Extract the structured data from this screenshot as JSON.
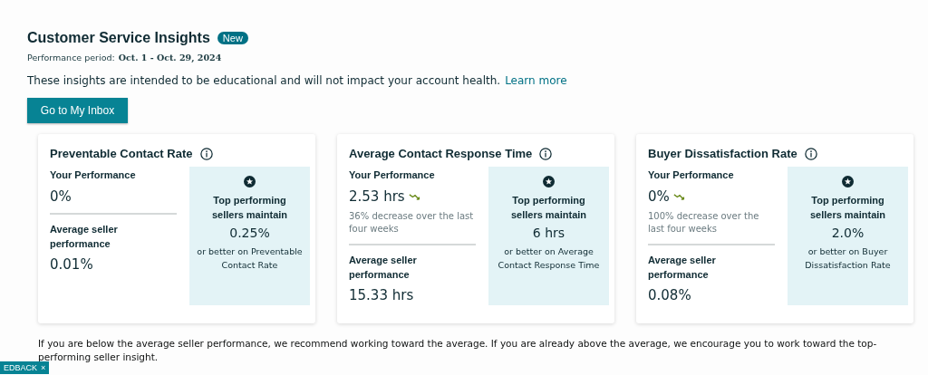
{
  "header": {
    "title": "Customer Service Insights",
    "badge": "New",
    "period_label": "Performance period:",
    "period_value": "Oct. 1 - Oct. 29, 2024"
  },
  "intro": {
    "text": "These insights are intended to be educational and will not impact your account health.",
    "link": "Learn more"
  },
  "inbox_button": "Go to My Inbox",
  "cards": [
    {
      "title": "Preventable Contact Rate",
      "your_label": "Your Performance",
      "your_value": "0%",
      "trend_down": false,
      "avg_label": "Average seller performance",
      "avg_value": "0.01%",
      "top_label": "Top performing sellers maintain",
      "top_value": "0.25%",
      "top_note": "or better on Preventable Contact Rate"
    },
    {
      "title": "Average Contact Response Time",
      "your_label": "Your Performance",
      "your_value": "2.53 hrs",
      "trend_down": true,
      "change": "36% decrease over the last four weeks",
      "avg_label": "Average seller performance",
      "avg_value": "15.33 hrs",
      "top_label": "Top performing sellers maintain",
      "top_value": "6 hrs",
      "top_note": "or better on Average Contact Response Time"
    },
    {
      "title": "Buyer Dissatisfaction Rate",
      "your_label": "Your Performance",
      "your_value": "0%",
      "trend_down": true,
      "change": "100% decrease over the last four weeks",
      "avg_label": "Average seller performance",
      "avg_value": "0.08%",
      "top_label": "Top performing sellers maintain",
      "top_value": "2.0%",
      "top_note": "or better on Buyer Dissatisfaction Rate"
    }
  ],
  "footnote": "If you are below the average seller performance, we recommend working toward the average. If you are already above the average, we encourage you to work toward the top-performing seller insight.",
  "feedback_tab": {
    "label": "EDBACK",
    "close": "×"
  }
}
